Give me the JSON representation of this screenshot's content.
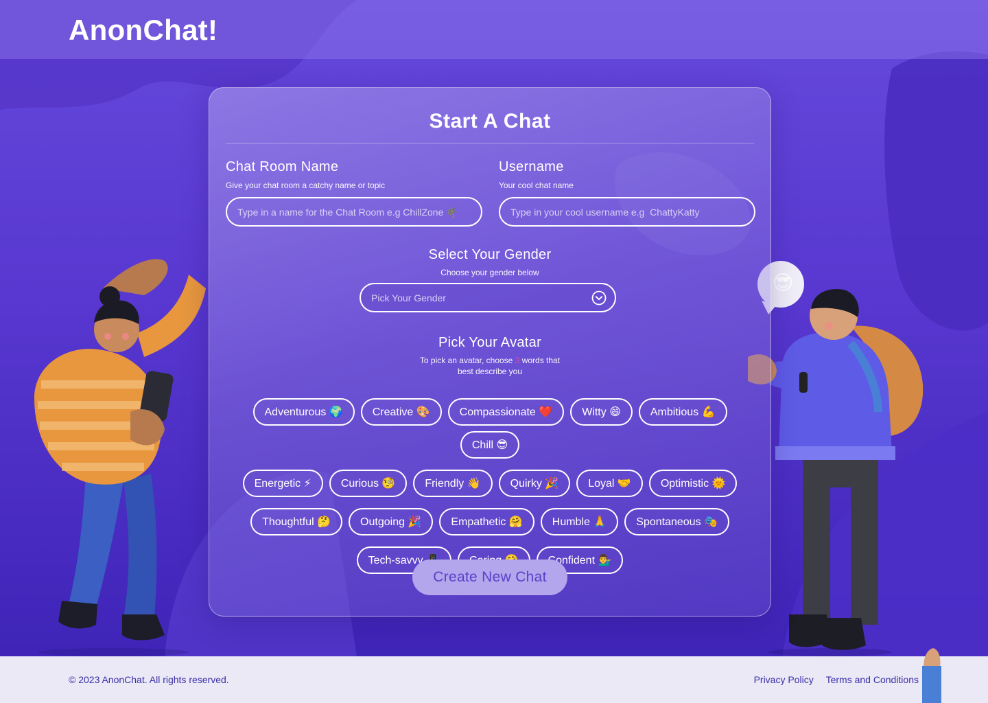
{
  "header": {
    "logo": "AnonChat!"
  },
  "form": {
    "title": "Start A Chat",
    "room": {
      "label": "Chat Room Name",
      "hint": "Give your chat room a catchy name or topic",
      "placeholder": "Type in a name for the Chat Room e.g ChillZone 🌴",
      "value": ""
    },
    "username": {
      "label": "Username",
      "hint": "Your cool chat name",
      "placeholder": "Type in your cool username e.g  ChattyKatty",
      "value": ""
    },
    "gender": {
      "label": "Select Your Gender",
      "hint": "Choose your gender below",
      "selected": "Pick Your Gender"
    },
    "avatar": {
      "label": "Pick Your Avatar",
      "hint_prefix": "To pick an avatar, choose ",
      "hint_count": "3",
      "hint_line1_suffix": " words that",
      "hint_line2": "best describe you"
    },
    "traits": [
      [
        "Adventurous 🌍",
        "Creative 🎨",
        "Compassionate ❤️",
        "Witty 😄",
        "Ambitious 💪",
        "Chill 😎"
      ],
      [
        "Energetic ⚡",
        "Curious 🧐",
        "Friendly 👋",
        "Quirky 🎉",
        "Loyal 🤝",
        "Optimistic 🌞"
      ],
      [
        "Thoughtful 🤔",
        "Outgoing 🎉",
        "Empathetic 🤗",
        "Humble 🙏",
        "Spontaneous 🎭"
      ],
      [
        "Tech-savvy 📱",
        "Caring 🤗",
        "Confident 💁‍♂️"
      ]
    ],
    "submit_label": "Create New Chat"
  },
  "footer": {
    "copyright": "© 2023 AnonChat. All rights reserved.",
    "links": [
      "Privacy Policy",
      "Terms and Conditions"
    ]
  },
  "decor": {
    "left_figure": "3d-woman-with-phone",
    "right_figure": "3d-man-with-backpack",
    "emoji_bubble": "😎"
  },
  "colors": {
    "primary": "#5a3fd6",
    "accent": "#e04dae",
    "footer_bg": "#ebe9f6",
    "footer_text": "#3a2ea8"
  }
}
